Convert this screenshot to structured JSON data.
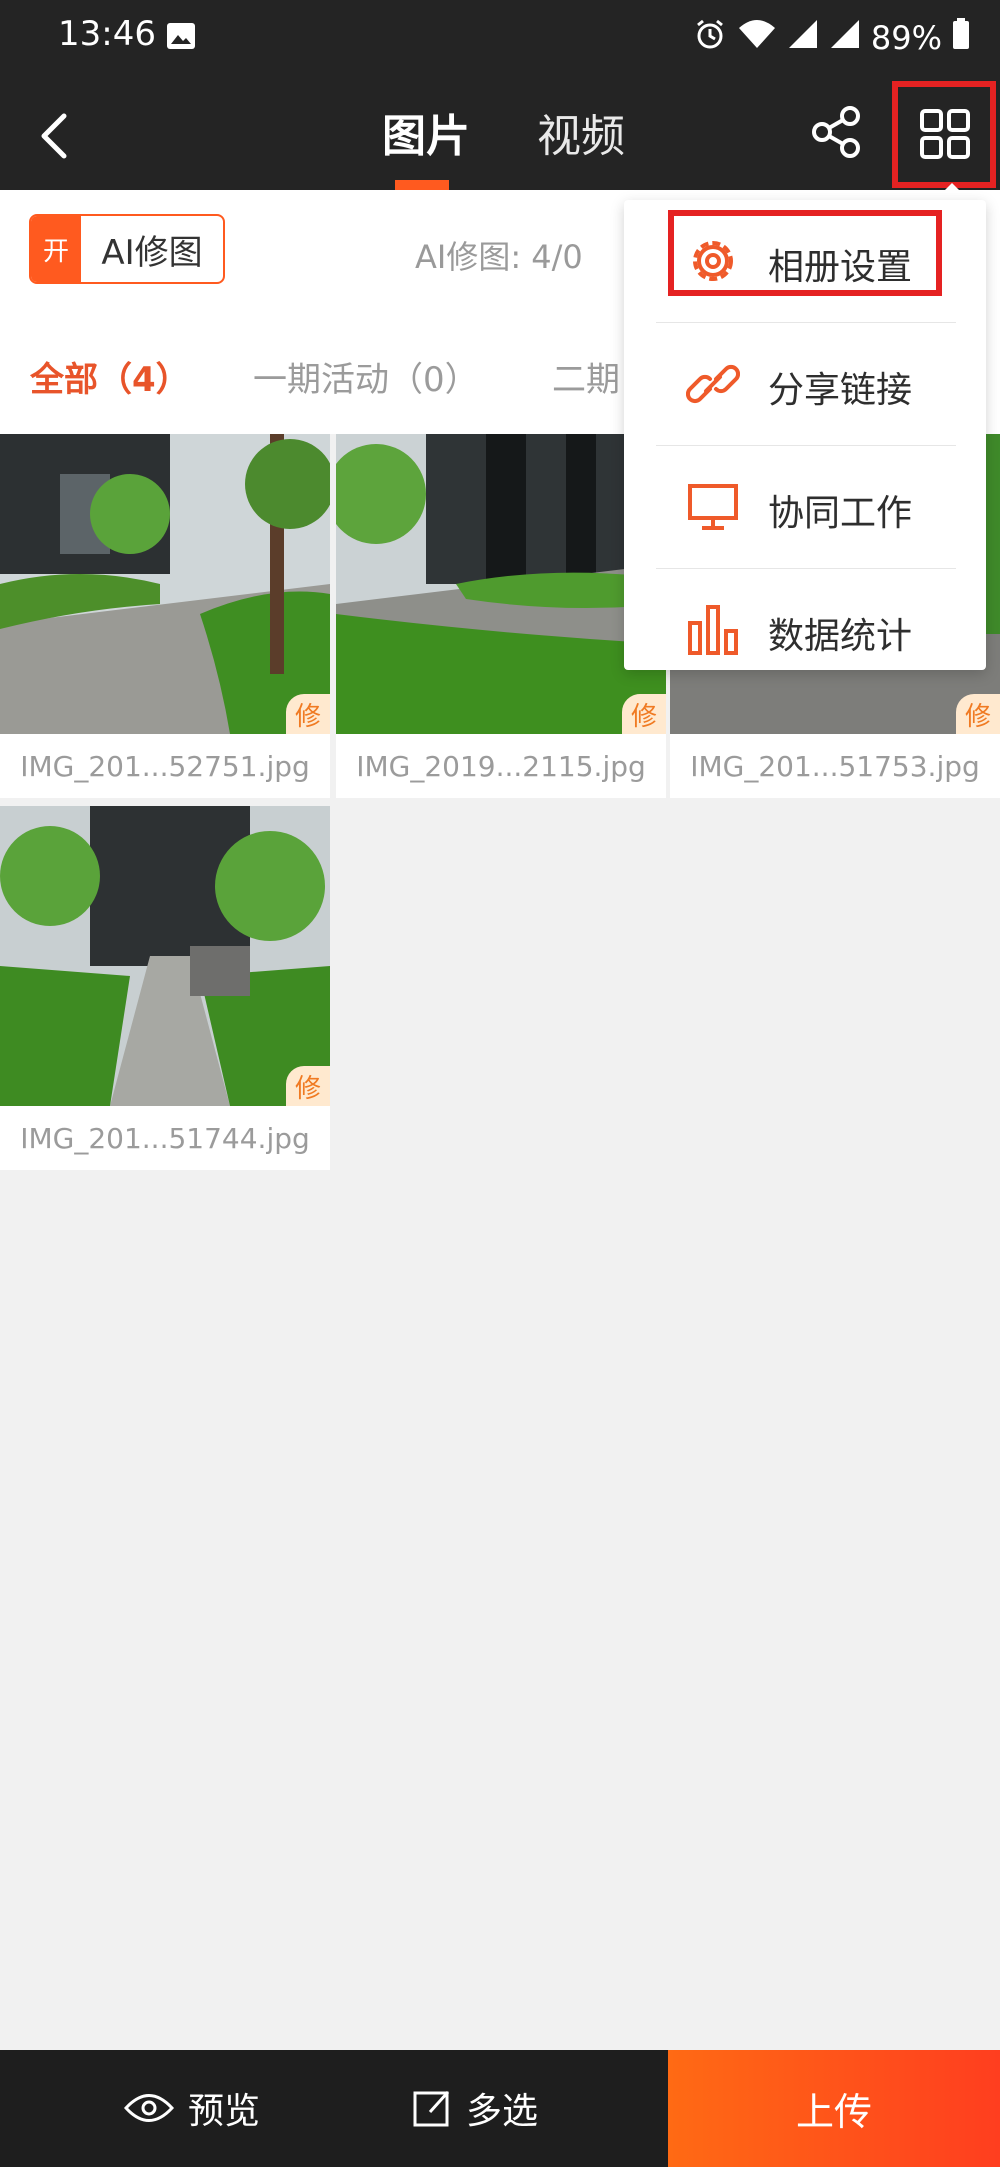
{
  "status_bar": {
    "time": "13:46",
    "battery": "89%"
  },
  "header": {
    "tabs": [
      {
        "label": "图片"
      },
      {
        "label": "视频"
      }
    ]
  },
  "ai_bar": {
    "toggle_state": "开",
    "toggle_label": "AI修图",
    "count_text": "AI修图: 4/0"
  },
  "categories": [
    {
      "label": "全部（4）"
    },
    {
      "label": "一期活动（0）"
    },
    {
      "label": "二期"
    }
  ],
  "photos": [
    {
      "filename": "IMG_201...52751.jpg",
      "badge": "修"
    },
    {
      "filename": "IMG_2019...2115.jpg",
      "badge": "修"
    },
    {
      "filename": "IMG_201...51753.jpg",
      "badge": "修"
    },
    {
      "filename": "IMG_201...51744.jpg",
      "badge": "修"
    }
  ],
  "menu": {
    "items": [
      {
        "label": "相册设置",
        "icon": "gear-icon"
      },
      {
        "label": "分享链接",
        "icon": "link-icon"
      },
      {
        "label": "协同工作",
        "icon": "monitor-icon"
      },
      {
        "label": "数据统计",
        "icon": "bar-chart-icon"
      }
    ]
  },
  "bottom_bar": {
    "preview_label": "预览",
    "multiselect_label": "多选",
    "upload_label": "上传"
  },
  "colors": {
    "accent": "#ff5a1f",
    "highlight_box": "#e52222",
    "bar_bg": "#242424"
  }
}
